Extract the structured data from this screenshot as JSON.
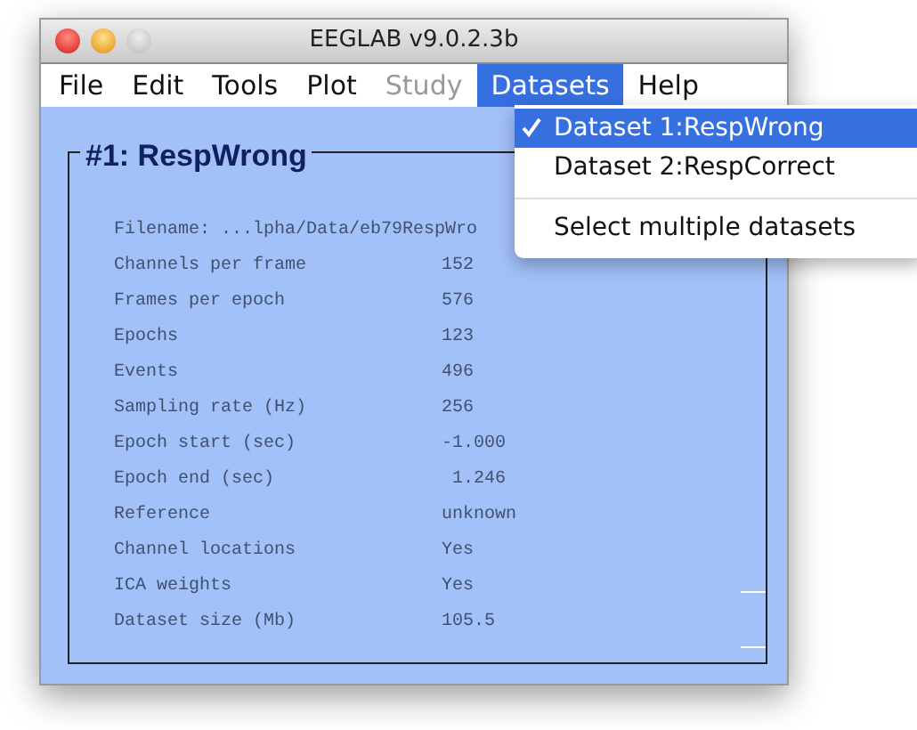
{
  "window": {
    "title": "EEGLAB v9.0.2.3b"
  },
  "menu": [
    {
      "label": "File",
      "disabled": false,
      "selected": false
    },
    {
      "label": "Edit",
      "disabled": false,
      "selected": false
    },
    {
      "label": "Tools",
      "disabled": false,
      "selected": false
    },
    {
      "label": "Plot",
      "disabled": false,
      "selected": false
    },
    {
      "label": "Study",
      "disabled": true,
      "selected": false
    },
    {
      "label": "Datasets",
      "disabled": false,
      "selected": true
    },
    {
      "label": "Help",
      "disabled": false,
      "selected": false
    }
  ],
  "dropdown": [
    {
      "kind": "item",
      "label": "Dataset 1:RespWrong",
      "checked": true,
      "selected": true
    },
    {
      "kind": "item",
      "label": "Dataset 2:RespCorrect",
      "checked": false,
      "selected": false
    },
    {
      "kind": "separator"
    },
    {
      "kind": "item",
      "label": "Select multiple datasets",
      "checked": false,
      "selected": false
    }
  ],
  "panel": {
    "title": "#1: RespWrong",
    "filename": "Filename: ...lpha/Data/eb79RespWro",
    "rows": [
      {
        "label": "Channels per frame",
        "value": "152"
      },
      {
        "label": "Frames per epoch",
        "value": "576"
      },
      {
        "label": "Epochs",
        "value": "123"
      },
      {
        "label": "Events",
        "value": "496"
      },
      {
        "label": "Sampling rate (Hz)",
        "value": "256"
      },
      {
        "label": "Epoch start (sec)",
        "value": "-1.000"
      },
      {
        "label": "Epoch end (sec)",
        "value": " 1.246"
      },
      {
        "label": "Reference",
        "value": "unknown"
      },
      {
        "label": "Channel locations",
        "value": "Yes"
      },
      {
        "label": "ICA weights",
        "value": "Yes"
      },
      {
        "label": "Dataset size (Mb)",
        "value": "105.5"
      }
    ]
  }
}
